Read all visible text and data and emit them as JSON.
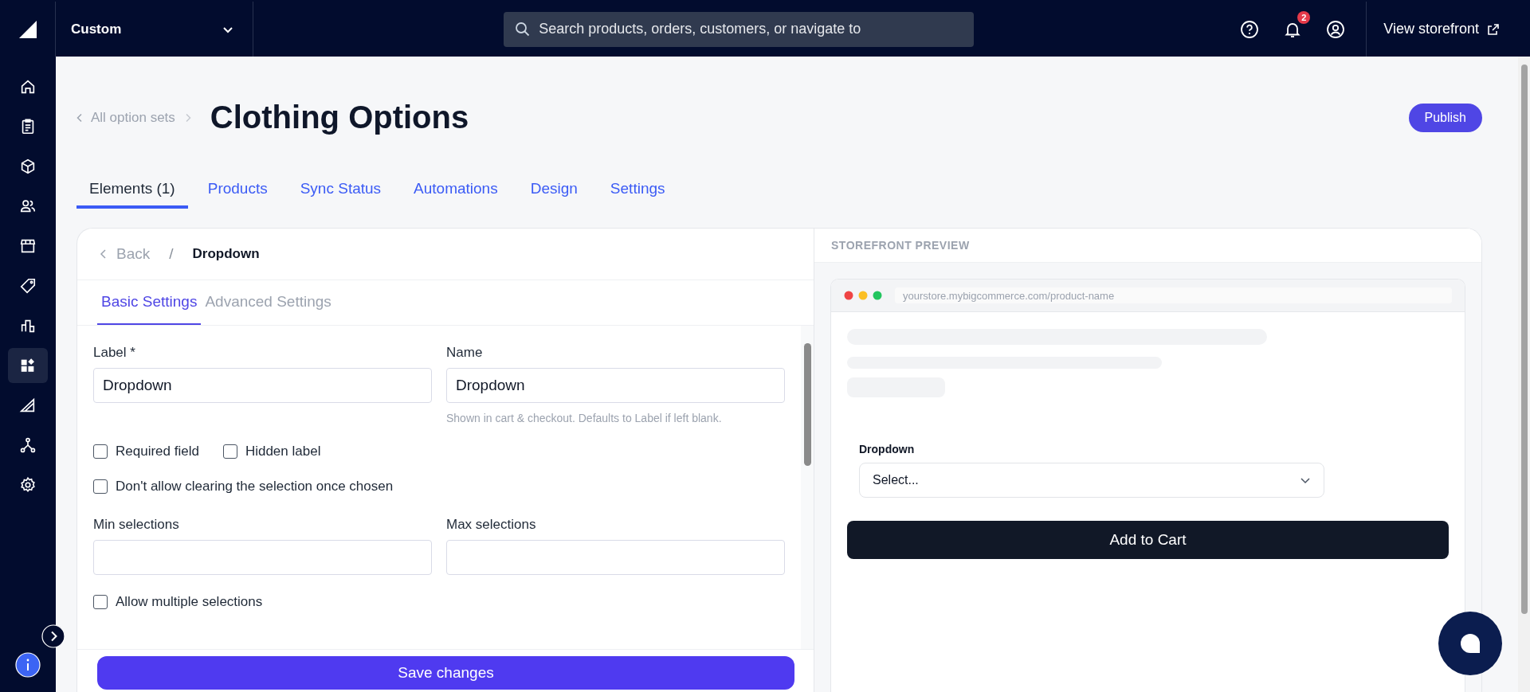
{
  "topbar": {
    "store_name": "Custom",
    "search": {
      "placeholder": "Search products, orders, customers, or navigate to"
    },
    "notification_count": "2",
    "view_storefront": "View storefront"
  },
  "sidebar": {
    "items": [
      {
        "kind": "home",
        "selected": false
      },
      {
        "kind": "clipboard",
        "selected": false
      },
      {
        "kind": "box",
        "selected": false
      },
      {
        "kind": "people",
        "selected": false
      },
      {
        "kind": "store",
        "selected": false
      },
      {
        "kind": "tag",
        "selected": false
      },
      {
        "kind": "chart",
        "selected": false
      },
      {
        "kind": "widgets",
        "selected": true
      },
      {
        "kind": "ruler",
        "selected": false
      },
      {
        "kind": "network",
        "selected": false
      },
      {
        "kind": "gear",
        "selected": false
      }
    ]
  },
  "breadcrumb": "All option sets",
  "title": "Clothing Options",
  "publish": "Publish",
  "tabs": [
    {
      "label": "Elements (1)",
      "selected": true
    },
    {
      "label": "Products",
      "selected": false
    },
    {
      "label": "Sync Status",
      "selected": false
    },
    {
      "label": "Automations",
      "selected": false
    },
    {
      "label": "Design",
      "selected": false
    },
    {
      "label": "Settings",
      "selected": false
    }
  ],
  "editor": {
    "back": "Back",
    "separator": "/",
    "current": "Dropdown",
    "subtabs": [
      {
        "label": "Basic Settings",
        "selected": true
      },
      {
        "label": "Advanced Settings",
        "selected": false
      }
    ],
    "label_field": {
      "label": "Label *",
      "value": "Dropdown"
    },
    "name_field": {
      "label": "Name",
      "value": "Dropdown",
      "hint": "Shown in cart & checkout. Defaults to Label if left blank."
    },
    "checkbox_rows_a": [
      [
        {
          "label": "Required field",
          "checked": false
        },
        {
          "label": "Hidden label",
          "checked": false
        }
      ],
      [
        {
          "label": "Don't allow clearing the selection once chosen",
          "checked": false
        }
      ]
    ],
    "min_field": {
      "label": "Min selections"
    },
    "max_field": {
      "label": "Max selections"
    },
    "checkbox_rows_b": [
      [
        {
          "label": "Allow multiple selections",
          "checked": false
        }
      ]
    ],
    "save": "Save changes"
  },
  "preview": {
    "heading": "STOREFRONT PREVIEW",
    "url": "yourstore.mybigcommerce.com/product-name",
    "dropdown_label": "Dropdown",
    "select_placeholder": "Select...",
    "add_to_cart": "Add to Cart"
  }
}
